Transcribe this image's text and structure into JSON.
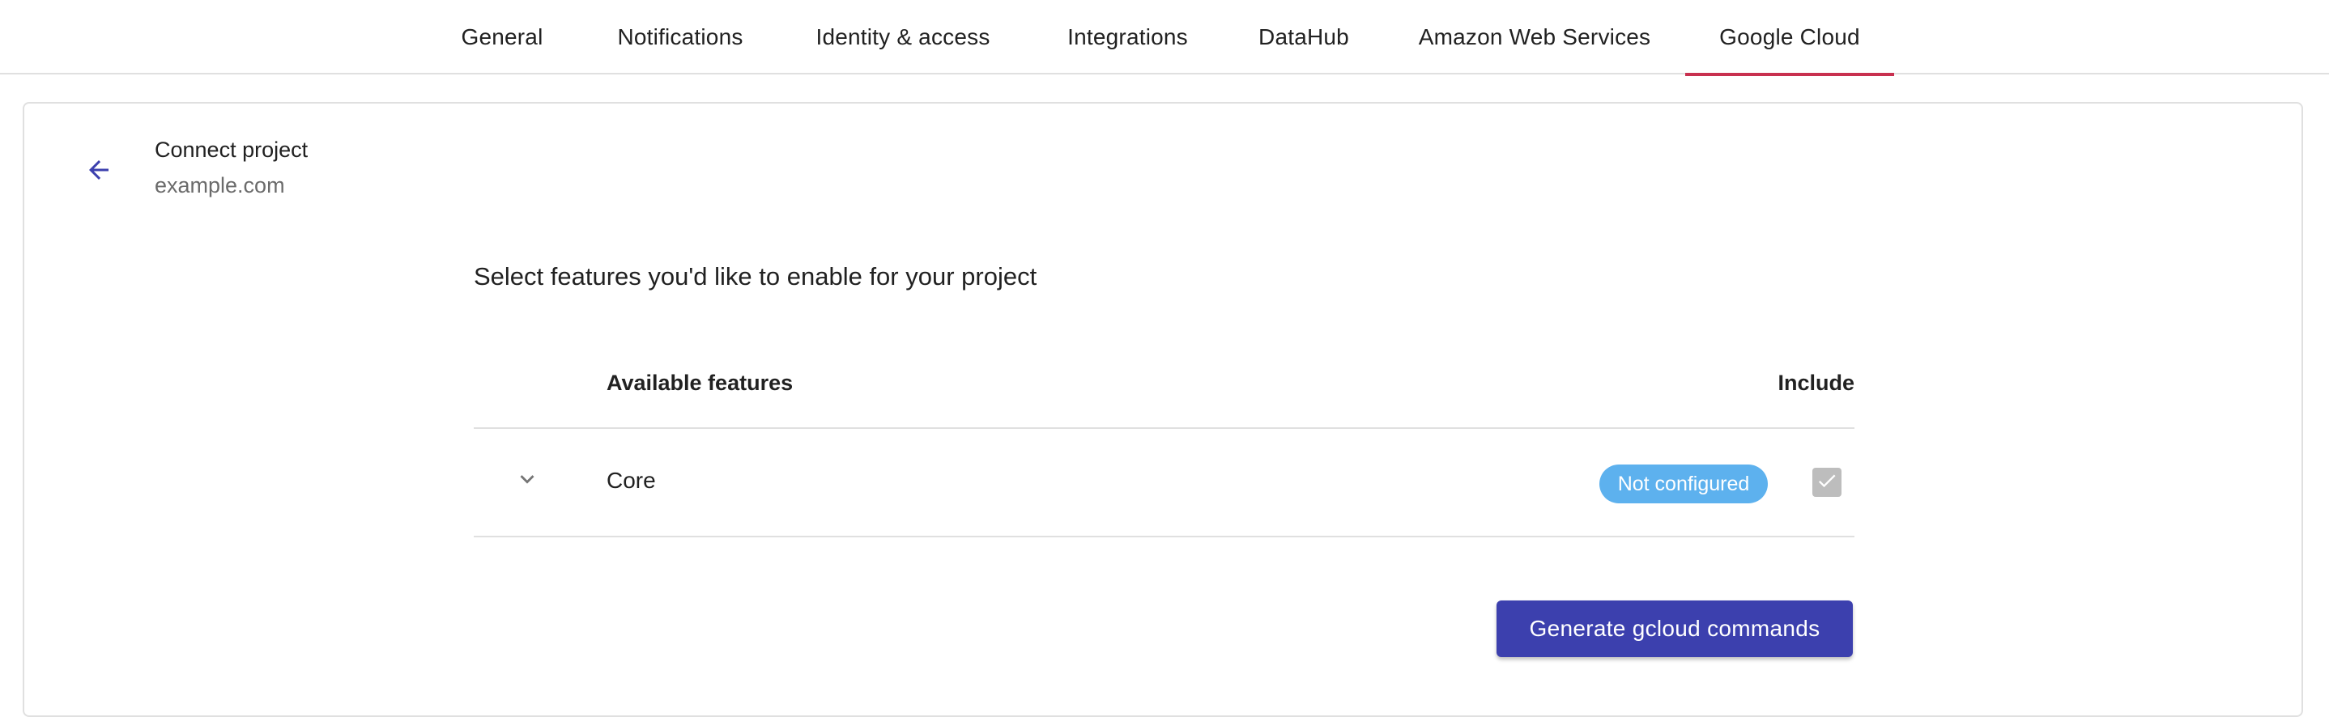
{
  "tabs": [
    {
      "label": "General",
      "active": false
    },
    {
      "label": "Notifications",
      "active": false
    },
    {
      "label": "Identity & access",
      "active": false
    },
    {
      "label": "Integrations",
      "active": false
    },
    {
      "label": "DataHub",
      "active": false
    },
    {
      "label": "Amazon Web Services",
      "active": false
    },
    {
      "label": "Google Cloud",
      "active": true
    }
  ],
  "header": {
    "back_icon": "arrow-left-icon",
    "title": "Connect project",
    "subtitle": "example.com"
  },
  "section": {
    "title": "Select features you'd like to enable for your project"
  },
  "table": {
    "columns": {
      "features": "Available features",
      "include": "Include"
    },
    "rows": [
      {
        "expand_icon": "chevron-down-icon",
        "name": "Core",
        "status": "Not configured",
        "included": true,
        "include_disabled": true
      }
    ]
  },
  "actions": {
    "generate_label": "Generate gcloud commands"
  },
  "colors": {
    "accent": "#3c40ae",
    "active_tab_indicator": "#c8304f",
    "status_badge": "#5db1ee",
    "checkbox_disabled": "#bdbdbd"
  }
}
